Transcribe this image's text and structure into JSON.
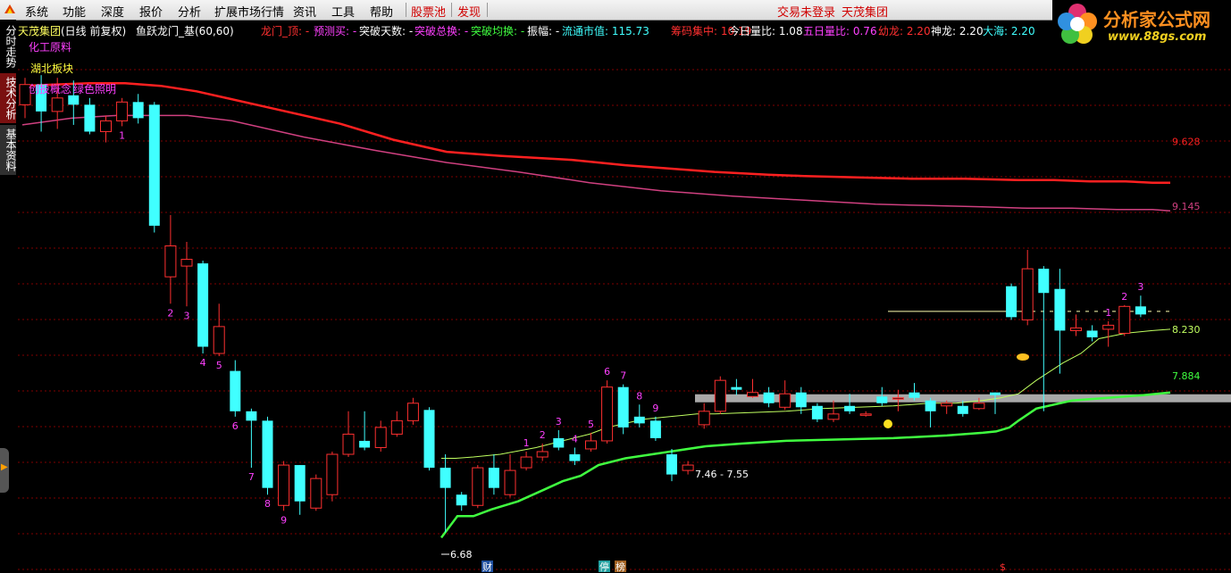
{
  "menu": {
    "items": [
      {
        "label": "系统"
      },
      {
        "label": "功能"
      },
      {
        "label": "深度"
      },
      {
        "label": "报价"
      },
      {
        "label": "分析"
      },
      {
        "label": "扩展市场行情"
      },
      {
        "label": "资讯"
      },
      {
        "label": "工具"
      },
      {
        "label": "帮助"
      }
    ],
    "highlight_items": [
      {
        "label": "股票池"
      },
      {
        "label": "发现"
      }
    ],
    "login_status": "交易未登录",
    "stock_name": "天茂集团"
  },
  "brand": {
    "title": "分析家公式网",
    "url": "www.88gs.com"
  },
  "side_tabs": [
    {
      "label": "分时走势",
      "active": false
    },
    {
      "label": "技术分析",
      "active": true
    },
    {
      "label": "基本资料",
      "active": false
    }
  ],
  "header": {
    "stock": "天茂集团",
    "mode": "(日线 前复权)",
    "formula": "鱼跃龙门_基(60,60)"
  },
  "indicators": [
    {
      "label": "龙门_顶:",
      "value": "-",
      "color": "#ff3030"
    },
    {
      "label": "预测买:",
      "value": "-",
      "color": "#ff40ff"
    },
    {
      "label": "突破天数:",
      "value": "-",
      "color": "#ffffff"
    },
    {
      "label": "突破总换:",
      "value": "-",
      "color": "#ff40ff"
    },
    {
      "label": "突破均换:",
      "value": "-",
      "color": "#40ff40"
    },
    {
      "label": "振幅:",
      "value": "-",
      "color": "#ffffff"
    },
    {
      "label": "流通市值:",
      "value": "115.73",
      "color": "#40ffff"
    },
    {
      "label": "筹码集中:",
      "value": "10.19",
      "color": "#ff3030"
    },
    {
      "label": "今日量比:",
      "value": "1.08",
      "color": "#ffffff"
    },
    {
      "label": "五日量比:",
      "value": "0.76",
      "color": "#ff40ff"
    },
    {
      "label": "幼龙:",
      "value": "2.20",
      "color": "#ff3030"
    },
    {
      "label": "神龙:",
      "value": "2.20",
      "color": "#ffffff"
    },
    {
      "label": "大海:",
      "value": "2.20",
      "color": "#40ffff"
    }
  ],
  "notes": [
    {
      "text": "化工原料",
      "color": "#ff40ff"
    },
    {
      "text": "湖北板块",
      "color": "#ffff40"
    },
    {
      "text": "创投概念",
      "color": "#ff40ff"
    },
    {
      "text": "绿色照明",
      "color": "#ff40ff"
    }
  ],
  "price_labels": {
    "ma_red": "9.628",
    "ma_pink": "9.145",
    "line_yellow": "8.230",
    "line_green": "7.884",
    "low": "6.68",
    "range": "7.46 - 7.55"
  },
  "markers": {
    "cai": "财",
    "ting": "停",
    "bang": "榜",
    "dollar": "$"
  },
  "colors": {
    "up": "#ff3030",
    "down": "#40ffff",
    "ma_red": "#ff2020",
    "ma_pink": "#d04080",
    "line_yellow": "#c0ff60",
    "line_green": "#40ff40",
    "grid": "#800000",
    "count_text": "#ff40ff"
  },
  "chart_data": {
    "type": "candlestick",
    "candles": [
      {
        "o": 9.9,
        "c": 10.05,
        "h": 10.1,
        "l": 9.8
      },
      {
        "o": 10.05,
        "c": 9.85,
        "h": 10.12,
        "l": 9.7
      },
      {
        "o": 9.85,
        "c": 9.95,
        "h": 10.1,
        "l": 9.72
      },
      {
        "o": 9.97,
        "c": 9.9,
        "h": 10.08,
        "l": 9.75
      },
      {
        "o": 9.9,
        "c": 9.7,
        "h": 9.95,
        "l": 9.68
      },
      {
        "o": 9.7,
        "c": 9.78,
        "h": 9.82,
        "l": 9.62
      },
      {
        "o": 9.78,
        "c": 9.92,
        "h": 9.95,
        "l": 9.74
      },
      {
        "o": 9.92,
        "c": 9.8,
        "h": 9.98,
        "l": 9.76
      },
      {
        "o": 9.9,
        "c": 9.0,
        "h": 9.92,
        "l": 8.95
      },
      {
        "o": 8.62,
        "c": 8.85,
        "h": 9.08,
        "l": 8.42
      },
      {
        "o": 8.7,
        "c": 8.75,
        "h": 8.88,
        "l": 8.4
      },
      {
        "o": 8.72,
        "c": 8.1,
        "h": 8.74,
        "l": 8.05
      },
      {
        "o": 8.05,
        "c": 8.25,
        "h": 8.42,
        "l": 8.03
      },
      {
        "o": 7.92,
        "c": 7.62,
        "h": 8.0,
        "l": 7.58
      },
      {
        "o": 7.62,
        "c": 7.55,
        "h": 7.64,
        "l": 7.2
      },
      {
        "o": 7.55,
        "c": 7.05,
        "h": 7.58,
        "l": 7.0
      },
      {
        "o": 6.92,
        "c": 7.22,
        "h": 7.25,
        "l": 6.88
      },
      {
        "o": 7.22,
        "c": 6.95,
        "h": 7.22,
        "l": 6.85
      },
      {
        "o": 6.9,
        "c": 7.12,
        "h": 7.15,
        "l": 6.88
      },
      {
        "o": 7.0,
        "c": 7.3,
        "h": 7.32,
        "l": 6.95
      },
      {
        "o": 7.3,
        "c": 7.45,
        "h": 7.62,
        "l": 7.28
      },
      {
        "o": 7.4,
        "c": 7.35,
        "h": 7.62,
        "l": 7.33
      },
      {
        "o": 7.35,
        "c": 7.5,
        "h": 7.55,
        "l": 7.32
      },
      {
        "o": 7.45,
        "c": 7.55,
        "h": 7.62,
        "l": 7.43
      },
      {
        "o": 7.55,
        "c": 7.68,
        "h": 7.72,
        "l": 7.52
      },
      {
        "o": 7.63,
        "c": 7.2,
        "h": 7.65,
        "l": 7.18
      },
      {
        "o": 7.2,
        "c": 7.05,
        "h": 7.3,
        "l": 6.72
      },
      {
        "o": 7.0,
        "c": 6.92,
        "h": 7.02,
        "l": 6.88
      },
      {
        "o": 6.92,
        "c": 7.2,
        "h": 7.22,
        "l": 6.9
      },
      {
        "o": 7.2,
        "c": 7.05,
        "h": 7.3,
        "l": 7.0
      },
      {
        "o": 7.0,
        "c": 7.18,
        "h": 7.3,
        "l": 6.98
      },
      {
        "o": 7.2,
        "c": 7.28,
        "h": 7.32,
        "l": 7.18
      },
      {
        "o": 7.28,
        "c": 7.32,
        "h": 7.38,
        "l": 7.25
      },
      {
        "o": 7.42,
        "c": 7.35,
        "h": 7.48,
        "l": 7.33
      },
      {
        "o": 7.3,
        "c": 7.25,
        "h": 7.35,
        "l": 7.22
      },
      {
        "o": 7.34,
        "c": 7.4,
        "h": 7.46,
        "l": 7.32
      },
      {
        "o": 7.4,
        "c": 7.8,
        "h": 7.85,
        "l": 7.38
      },
      {
        "o": 7.8,
        "c": 7.5,
        "h": 7.82,
        "l": 7.45
      },
      {
        "o": 7.58,
        "c": 7.53,
        "h": 7.67,
        "l": 7.5
      },
      {
        "o": 7.55,
        "c": 7.42,
        "h": 7.58,
        "l": 7.4
      },
      {
        "o": 7.3,
        "c": 7.15,
        "h": 7.34,
        "l": 7.1
      },
      {
        "o": 7.18,
        "c": 7.22,
        "h": 7.25,
        "l": 7.15
      },
      {
        "o": 7.52,
        "c": 7.62,
        "h": 7.68,
        "l": 7.49
      },
      {
        "o": 7.62,
        "c": 7.85,
        "h": 7.88,
        "l": 7.6
      },
      {
        "o": 7.8,
        "c": 7.78,
        "h": 7.86,
        "l": 7.74
      },
      {
        "o": 7.73,
        "c": 7.76,
        "h": 7.86,
        "l": 7.72
      },
      {
        "o": 7.76,
        "c": 7.68,
        "h": 7.8,
        "l": 7.65
      },
      {
        "o": 7.65,
        "c": 7.75,
        "h": 7.85,
        "l": 7.63
      },
      {
        "o": 7.76,
        "c": 7.65,
        "h": 7.8,
        "l": 7.6
      },
      {
        "o": 7.66,
        "c": 7.56,
        "h": 7.68,
        "l": 7.54
      },
      {
        "o": 7.56,
        "c": 7.6,
        "h": 7.7,
        "l": 7.54
      },
      {
        "o": 7.66,
        "c": 7.62,
        "h": 7.75,
        "l": 7.6
      },
      {
        "o": 7.6,
        "c": 7.6,
        "h": 7.62,
        "l": 7.58
      },
      {
        "o": 7.73,
        "c": 7.68,
        "h": 7.8,
        "l": 7.66
      },
      {
        "o": 7.72,
        "c": 7.72,
        "h": 7.78,
        "l": 7.62
      },
      {
        "o": 7.76,
        "c": 7.72,
        "h": 7.83,
        "l": 7.7
      },
      {
        "o": 7.7,
        "c": 7.62,
        "h": 7.72,
        "l": 7.5
      },
      {
        "o": 7.66,
        "c": 7.68,
        "h": 7.7,
        "l": 7.6
      },
      {
        "o": 7.66,
        "c": 7.6,
        "h": 7.7,
        "l": 7.58
      },
      {
        "o": 7.64,
        "c": 7.68,
        "h": 7.72,
        "l": 7.63
      },
      {
        "o": 7.76,
        "c": 7.74,
        "h": 7.76,
        "l": 7.6
      },
      {
        "o": 8.55,
        "c": 8.32,
        "h": 8.57,
        "l": 8.3
      },
      {
        "o": 8.3,
        "c": 8.68,
        "h": 8.82,
        "l": 8.26
      },
      {
        "o": 8.68,
        "c": 8.5,
        "h": 8.7,
        "l": 7.62
      },
      {
        "o": 8.53,
        "c": 8.22,
        "h": 8.68,
        "l": 7.9
      },
      {
        "o": 8.22,
        "c": 8.24,
        "h": 8.34,
        "l": 8.18
      },
      {
        "o": 8.22,
        "c": 8.17,
        "h": 8.26,
        "l": 8.14
      },
      {
        "o": 8.23,
        "c": 8.26,
        "h": 8.29,
        "l": 8.1
      },
      {
        "o": 8.2,
        "c": 8.4,
        "h": 8.41,
        "l": 8.18
      },
      {
        "o": 8.4,
        "c": 8.34,
        "h": 8.48,
        "l": 8.32
      }
    ],
    "ma_red": [
      10.04,
      10.05,
      10.06,
      10.06,
      10.04,
      10.0,
      9.88,
      9.76,
      9.64,
      9.55,
      9.52,
      9.49,
      9.45,
      9.42,
      9.4,
      9.38,
      9.37,
      9.36,
      9.35,
      9.35,
      9.34,
      9.34,
      9.33,
      9.33,
      9.32,
      9.32
    ],
    "ma_red_x": [
      25,
      60,
      100,
      140,
      180,
      220,
      300,
      380,
      440,
      500,
      560,
      640,
      700,
      760,
      800,
      860,
      900,
      960,
      1020,
      1080,
      1140,
      1180,
      1220,
      1260,
      1290,
      1310
    ],
    "ma_pink": [
      9.75,
      9.8,
      9.82,
      9.82,
      9.82,
      9.78,
      9.66,
      9.56,
      9.47,
      9.4,
      9.32,
      9.26,
      9.22,
      9.19,
      9.16,
      9.15,
      9.14,
      9.13,
      9.13,
      9.12,
      9.12,
      9.11
    ],
    "ma_pink_x": [
      25,
      80,
      130,
      170,
      210,
      260,
      340,
      420,
      500,
      580,
      660,
      740,
      820,
      900,
      980,
      1040,
      1100,
      1150,
      1200,
      1250,
      1290,
      1310
    ],
    "line_yellow": [
      7.27,
      7.27,
      7.28,
      7.3,
      7.35,
      7.4,
      7.45,
      7.5,
      7.53,
      7.56,
      7.58,
      7.6,
      7.6,
      7.61,
      7.62,
      7.64,
      7.65,
      7.66,
      7.68,
      7.68,
      7.7,
      7.72,
      7.75,
      7.85,
      7.98,
      8.05,
      8.16,
      8.2,
      8.22,
      8.23
    ],
    "line_yellow_x": [
      494,
      510,
      530,
      560,
      600,
      630,
      660,
      680,
      700,
      720,
      750,
      780,
      800,
      840,
      880,
      920,
      960,
      1000,
      1040,
      1070,
      1100,
      1120,
      1140,
      1160,
      1190,
      1210,
      1230,
      1260,
      1290,
      1310
    ],
    "line_green": [
      6.68,
      6.84,
      6.84,
      6.89,
      6.95,
      7.04,
      7.1,
      7.14,
      7.22,
      7.27,
      7.3,
      7.33,
      7.36,
      7.38,
      7.4,
      7.41,
      7.42,
      7.44,
      7.46,
      7.47,
      7.49,
      7.5,
      7.55,
      7.64,
      7.7,
      7.72,
      7.74,
      7.76
    ],
    "line_green_x": [
      494,
      512,
      530,
      550,
      580,
      610,
      630,
      650,
      670,
      700,
      730,
      760,
      790,
      830,
      880,
      940,
      1000,
      1060,
      1100,
      1115,
      1125,
      1130,
      1140,
      1160,
      1200,
      1240,
      1280,
      1310
    ],
    "count_labels": [
      {
        "i": 6,
        "t": "1",
        "pos": "below"
      },
      {
        "i": 9,
        "t": "2",
        "pos": "below"
      },
      {
        "i": 10,
        "t": "3",
        "pos": "below"
      },
      {
        "i": 11,
        "t": "4",
        "pos": "below"
      },
      {
        "i": 12,
        "t": "5",
        "pos": "below"
      },
      {
        "i": 13,
        "t": "6",
        "pos": "below"
      },
      {
        "i": 14,
        "t": "7",
        "pos": "below"
      },
      {
        "i": 15,
        "t": "8",
        "pos": "below"
      },
      {
        "i": 16,
        "t": "9",
        "pos": "below"
      },
      {
        "i": 31,
        "t": "1",
        "pos": "above"
      },
      {
        "i": 32,
        "t": "2",
        "pos": "above"
      },
      {
        "i": 33,
        "t": "3",
        "pos": "above"
      },
      {
        "i": 34,
        "t": "4",
        "pos": "above"
      },
      {
        "i": 35,
        "t": "5",
        "pos": "above"
      },
      {
        "i": 36,
        "t": "6",
        "pos": "above"
      },
      {
        "i": 37,
        "t": "7",
        "pos": "above"
      },
      {
        "i": 38,
        "t": "8",
        "pos": "above"
      },
      {
        "i": 39,
        "t": "9",
        "pos": "above"
      },
      {
        "i": 67,
        "t": "1",
        "pos": "above"
      },
      {
        "i": 68,
        "t": "2",
        "pos": "above"
      },
      {
        "i": 69,
        "t": "3",
        "pos": "above"
      }
    ],
    "ylim": [
      6.55,
      10.4
    ]
  }
}
